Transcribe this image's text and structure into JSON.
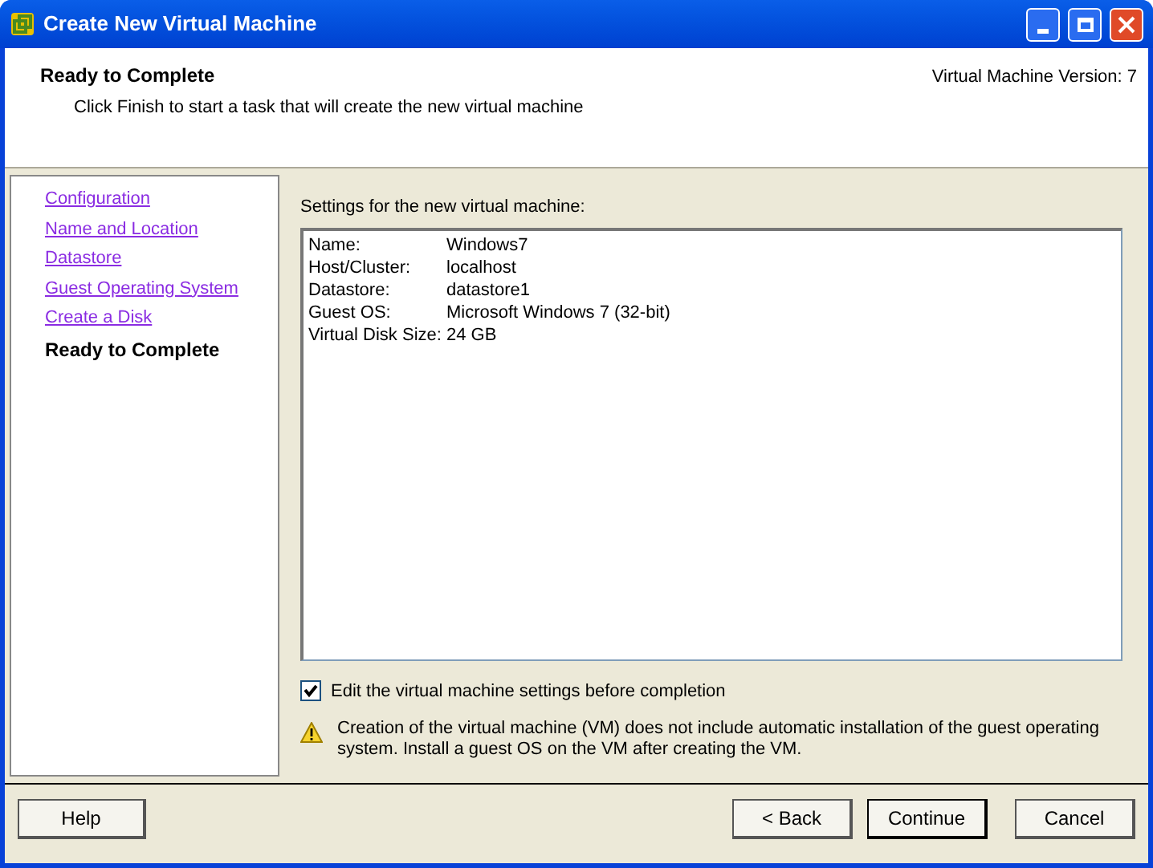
{
  "window": {
    "title": "Create New Virtual Machine"
  },
  "header": {
    "title": "Ready to Complete",
    "subtitle": "Click Finish to start a task that will create the new virtual machine",
    "version": "Virtual Machine Version: 7"
  },
  "steps": [
    {
      "label": "Configuration",
      "selected": false
    },
    {
      "label": "Name and Location",
      "selected": false
    },
    {
      "label": "Datastore",
      "selected": false
    },
    {
      "label": "Guest Operating System",
      "selected": false
    },
    {
      "label": "Create a Disk",
      "selected": false
    },
    {
      "label": "Ready to Complete",
      "selected": true
    }
  ],
  "settings": {
    "title": "Settings for the new virtual machine:",
    "rows": [
      {
        "key": "Name:",
        "value": "Windows7"
      },
      {
        "key": "Host/Cluster:",
        "value": "localhost"
      },
      {
        "key": "Datastore:",
        "value": "datastore1"
      },
      {
        "key": "Guest OS:",
        "value": "Microsoft Windows 7 (32-bit)"
      },
      {
        "key": "Virtual Disk Size:",
        "value": "24 GB"
      }
    ]
  },
  "edit_option": {
    "label": "Edit the virtual machine settings before completion",
    "checked": true
  },
  "warning": "Creation of the virtual machine (VM) does not include automatic installation of the guest operating system. Install a guest OS on the VM after creating the VM.",
  "buttons": {
    "help": "Help",
    "back": "< Back",
    "continue": "Continue",
    "cancel": "Cancel"
  }
}
